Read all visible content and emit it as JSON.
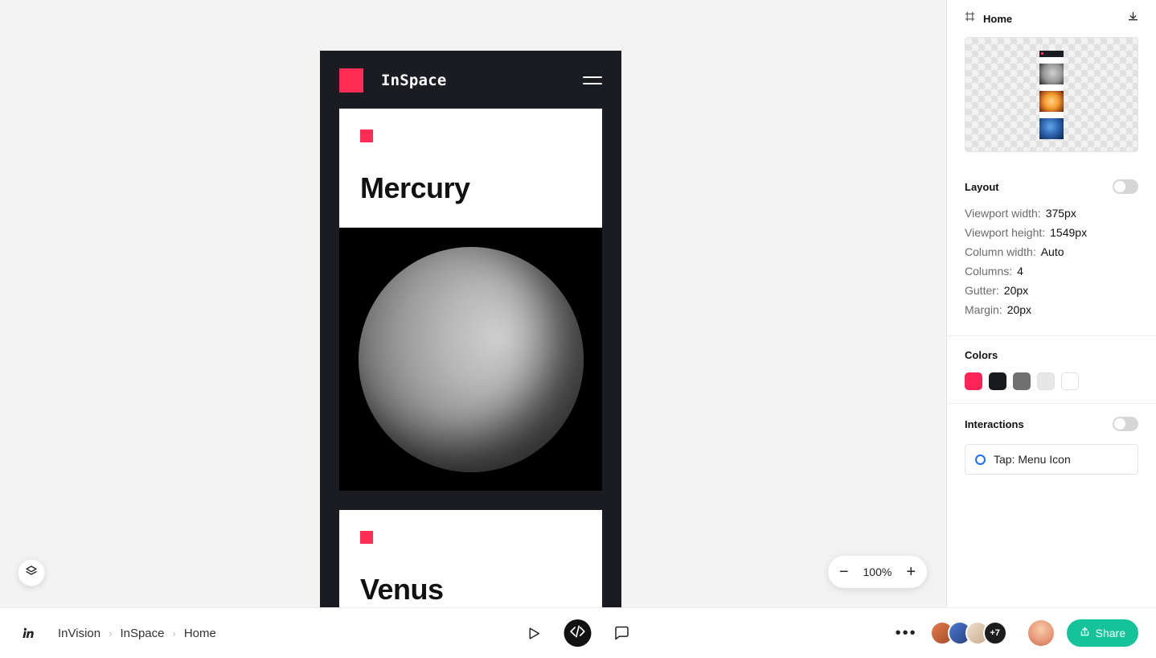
{
  "canvas": {
    "zoom_level": "100%"
  },
  "mockup": {
    "brand_name": "InSpace",
    "cards": [
      {
        "title": "Mercury"
      },
      {
        "title": "Venus"
      }
    ]
  },
  "inspector": {
    "frame_name": "Home",
    "layout": {
      "title": "Layout",
      "rows": {
        "viewport_width": {
          "label": "Viewport width:",
          "value": "375px"
        },
        "viewport_height": {
          "label": "Viewport height:",
          "value": "1549px"
        },
        "column_width": {
          "label": "Column width:",
          "value": "Auto"
        },
        "columns": {
          "label": "Columns:",
          "value": "4"
        },
        "gutter": {
          "label": "Gutter:",
          "value": "20px"
        },
        "margin": {
          "label": "Margin:",
          "value": "20px"
        }
      }
    },
    "colors": {
      "title": "Colors",
      "swatches": [
        "#ff2458",
        "#191a1d",
        "#6f6f6f",
        "#e7e7e7",
        "#ffffff"
      ]
    },
    "interactions": {
      "title": "Interactions",
      "items": [
        {
          "label": "Tap: Menu Icon"
        }
      ]
    }
  },
  "bottombar": {
    "breadcrumbs": [
      "InVision",
      "InSpace",
      "Home"
    ],
    "share_label": "Share",
    "overflow_count": "+7"
  }
}
